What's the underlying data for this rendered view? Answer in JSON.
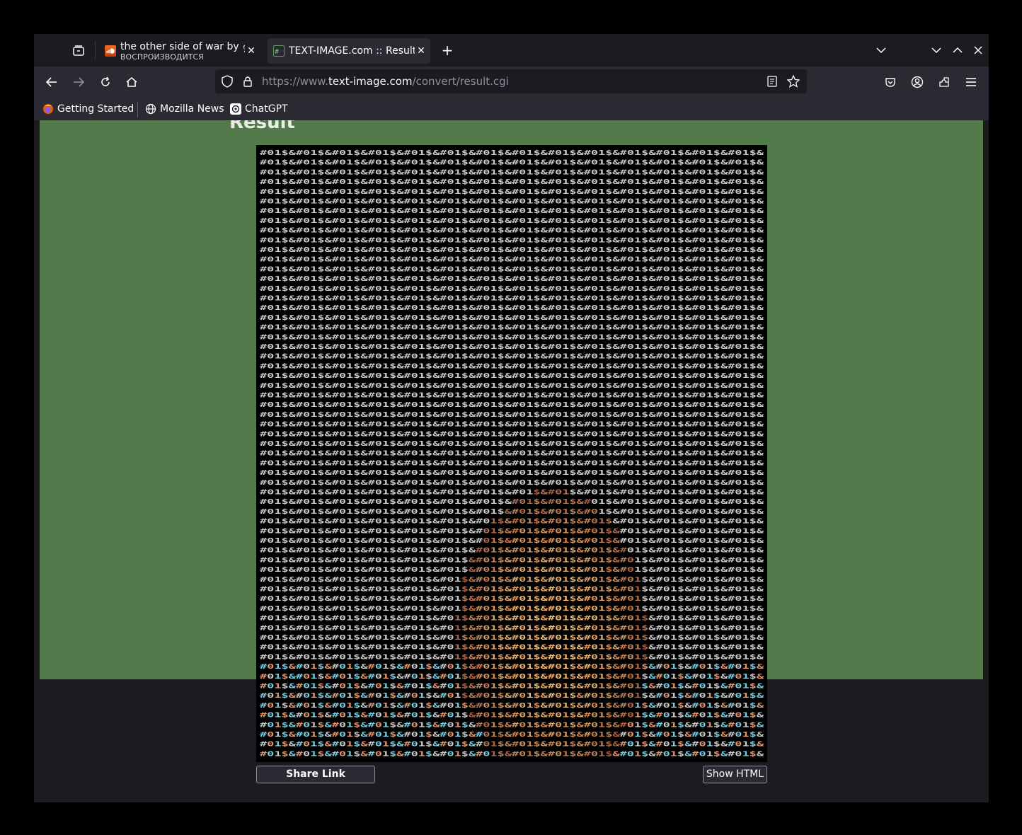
{
  "browser": {
    "tabs": [
      {
        "title": "the other side of war by 𝄞 (",
        "subtitle": "ВОСПРОИЗВОДИТСЯ",
        "favicon": "soundcloud-icon",
        "active": false
      },
      {
        "title": "TEXT-IMAGE.com :: Result",
        "subtitle": "",
        "favicon": "text-image-icon",
        "active": true
      }
    ],
    "url_prefix": "https://www.",
    "url_host": "text-image.com",
    "url_path": "/convert/result.cgi",
    "bookmarks": [
      {
        "label": "Getting Started",
        "icon": "firefox-icon"
      },
      {
        "label": "Mozilla News",
        "icon": "globe-icon"
      },
      {
        "label": "ChatGPT",
        "icon": "chatgpt-icon"
      }
    ]
  },
  "page": {
    "heading": "Result",
    "art": {
      "pattern": "#01$&",
      "rows": 63,
      "cols": 70,
      "background": "#000000",
      "base_color": "#c8c8c8"
    },
    "share_button": "Share Link",
    "show_html_button": "Show HTML"
  },
  "colors": {
    "page_background": "#527a4b",
    "chrome_dark": "#1c1b22",
    "chrome_toolbar": "#2b2a33"
  }
}
